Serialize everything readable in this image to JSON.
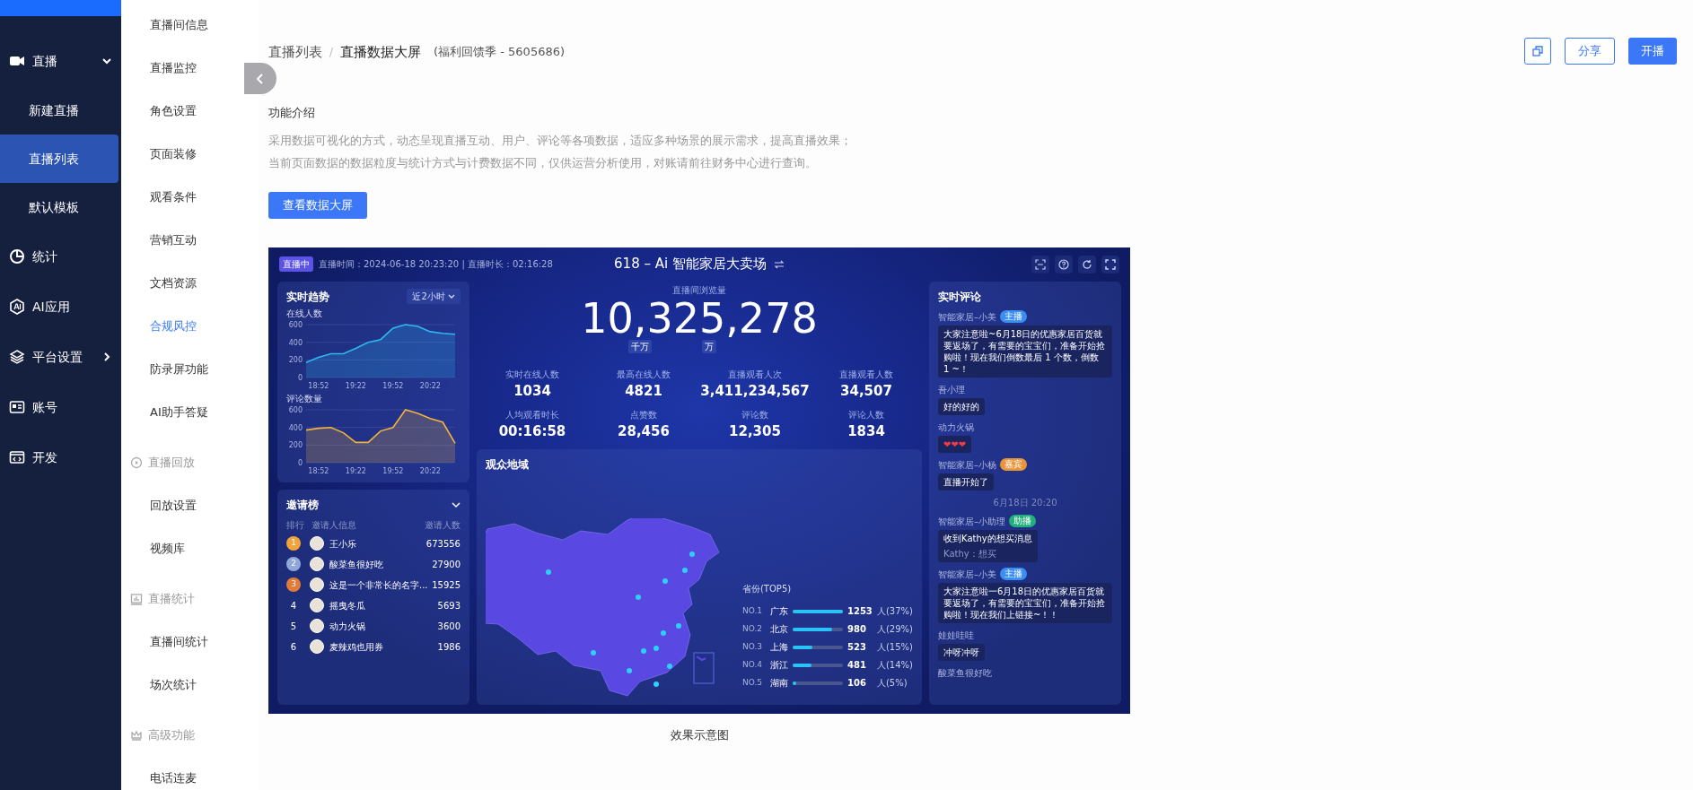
{
  "sidebar": {
    "items": [
      {
        "label": "直播",
        "kind": "group",
        "expanded": true,
        "selected": false,
        "children": [
          {
            "label": "新建直播",
            "selected": false
          },
          {
            "label": "直播列表",
            "selected": true
          },
          {
            "label": "默认模板",
            "selected": false
          }
        ]
      },
      {
        "label": "统计",
        "kind": "link",
        "selected": false
      },
      {
        "label": "AI应用",
        "kind": "link",
        "selected": false
      },
      {
        "label": "平台设置",
        "kind": "group",
        "expanded": false,
        "selected": false
      },
      {
        "label": "账号",
        "kind": "link",
        "selected": false
      },
      {
        "label": "开发",
        "kind": "link",
        "selected": false
      }
    ]
  },
  "subnav": {
    "sections": [
      {
        "items": [
          {
            "label": "直播间信息",
            "selected": false
          },
          {
            "label": "直播监控",
            "selected": false
          },
          {
            "label": "角色设置",
            "selected": false
          },
          {
            "label": "页面装修",
            "selected": false
          },
          {
            "label": "观看条件",
            "selected": false
          },
          {
            "label": "营销互动",
            "selected": false
          },
          {
            "label": "文档资源",
            "selected": false
          },
          {
            "label": "合规风控",
            "selected": true
          },
          {
            "label": "防录屏功能",
            "selected": false
          },
          {
            "label": "AI助手答疑",
            "selected": false
          }
        ]
      },
      {
        "heading": "直播回放",
        "items": [
          {
            "label": "回放设置",
            "selected": false
          },
          {
            "label": "视频库",
            "selected": false
          }
        ]
      },
      {
        "heading": "直播统计",
        "items": [
          {
            "label": "直播间统计",
            "selected": false
          },
          {
            "label": "场次统计",
            "selected": false
          }
        ]
      },
      {
        "heading": "高级功能",
        "items": [
          {
            "label": "电话连麦",
            "selected": false
          }
        ]
      }
    ]
  },
  "breadcrumb": {
    "items": [
      "直播列表",
      "直播数据大屏"
    ],
    "separator": "/",
    "note": "(福利回馈季 - 5605686)"
  },
  "actions": [
    "分享",
    "开播"
  ],
  "intro": {
    "title": "功能介绍",
    "lines": [
      "采用数据可视化的方式，动态呈现直播互动、用户、评论等各项数据，适应多种场景的展示需求，提高直播效果；",
      "当前页面数据的数据粒度与统计方式与计费数据不同，仅供运营分析使用，对账请前往财务中心进行查询。"
    ],
    "button": "查看数据大屏"
  },
  "preview": {
    "caption": "效果示意图",
    "dashboard": {
      "status": "直播中",
      "time_info": "直播时间：2024-06-18 20:23:20 | 直播时长：02:16:28",
      "title": "618 – Ai 智能家居大卖场",
      "trend": {
        "title": "实时趋势",
        "range": "近2小时",
        "charts": [
          {
            "chart_data": {
              "type": "area",
              "title": "在线人数",
              "categories": [
                null,
                "18:52",
                null,
                null,
                "19:22",
                null,
                null,
                "19:52",
                null,
                null,
                "20:22",
                null,
                null
              ],
              "grid": true,
              "ylim": [
                0,
                600
              ],
              "yticks": [
                0,
                200,
                400,
                600
              ],
              "series": [
                {
                  "color": "#2fb8f0",
                  "values": [
                    170,
                    230,
                    270,
                    270,
                    330,
                    400,
                    430,
                    560,
                    600,
                    580,
                    520,
                    500,
                    490
                  ]
                }
              ]
            }
          },
          {
            "chart_data": {
              "type": "area",
              "title": "评论数量",
              "categories": [
                null,
                "18:52",
                null,
                null,
                "19:22",
                null,
                null,
                "19:52",
                null,
                null,
                "20:22",
                null,
                null
              ],
              "grid": true,
              "ylim": [
                0,
                600
              ],
              "yticks": [
                0,
                200,
                400,
                600
              ],
              "series": [
                {
                  "color": "#f2b33d",
                  "values": [
                    370,
                    390,
                    400,
                    340,
                    230,
                    230,
                    360,
                    400,
                    600,
                    560,
                    500,
                    460,
                    220
                  ]
                }
              ]
            }
          }
        ]
      },
      "invite": {
        "title": "邀请榜",
        "columns": [
          "排行",
          "邀请人信息",
          "邀请人数"
        ],
        "rows": [
          {
            "rank": "1",
            "kind": "medal",
            "color": "#f0a53a",
            "name": "王小乐",
            "count": "673556"
          },
          {
            "rank": "2",
            "kind": "medal",
            "color": "#8fa8d8",
            "name": "酸菜鱼很好吃",
            "count": "27900"
          },
          {
            "rank": "3",
            "kind": "medal",
            "color": "#e27a3a",
            "name": "这是一个非常长的名字...",
            "count": "15925"
          },
          {
            "rank": "4",
            "kind": "plain",
            "name": "摇曳冬瓜",
            "count": "5693"
          },
          {
            "rank": "5",
            "kind": "plain",
            "name": "动力火锅",
            "count": "3600"
          },
          {
            "rank": "6",
            "kind": "plain",
            "name": "麦辣鸡也用券",
            "count": "1986"
          }
        ]
      },
      "views": {
        "label": "直播间浏览量",
        "value": "10,325,278",
        "units": [
          "千万",
          "万"
        ]
      },
      "stats": [
        {
          "label": "实时在线人数",
          "value": "1034"
        },
        {
          "label": "最高在线人数",
          "value": "4821"
        },
        {
          "label": "直播观看人次",
          "value": "3,411,234,567"
        },
        {
          "label": "直播观看人数",
          "value": "34,507"
        },
        {
          "label": "人均观看时长",
          "value": "00:16:58"
        },
        {
          "label": "点赞数",
          "value": "28,456"
        },
        {
          "label": "评论数",
          "value": "12,305"
        },
        {
          "label": "评论人数",
          "value": "1834"
        }
      ],
      "region": {
        "title": "观众地域",
        "top_title": "省份(TOP5)",
        "rows": [
          {
            "rank": "NO.1",
            "name": "广东",
            "level": 1.0,
            "count": "1253",
            "share": "人(37%)"
          },
          {
            "rank": "NO.2",
            "name": "北京",
            "level": 0.78,
            "count": "980",
            "share": "人(29%)"
          },
          {
            "rank": "NO.3",
            "name": "上海",
            "level": 0.4,
            "count": "523",
            "share": "人(15%)"
          },
          {
            "rank": "NO.4",
            "name": "浙江",
            "level": 0.37,
            "count": "481",
            "share": "人(14%)"
          },
          {
            "rank": "NO.5",
            "name": "湖南",
            "level": 0.08,
            "count": "106",
            "share": "人(5%)"
          }
        ]
      },
      "comments": {
        "title": "实时评论",
        "items": [
          {
            "kind": "message",
            "author": "智能家居–小美",
            "role": {
              "label": "主播",
              "color": "#3a8ef0"
            },
            "text": "大家注意啦~6月18日的优惠家居百货就要返场了，有需要的宝宝们，准备开始抢购啦！现在我们倒数最后 1 个数，倒数 1 ~！"
          },
          {
            "kind": "message",
            "author": "吾小理",
            "text": "好的好的"
          },
          {
            "kind": "message",
            "author": "动力火锅",
            "text": "❤❤❤"
          },
          {
            "kind": "message",
            "author": "智能家居–小杨",
            "role": {
              "label": "嘉宾",
              "color": "#e8953a"
            },
            "text": "直播开始了"
          },
          {
            "kind": "time",
            "text": "6月18日 20:20"
          },
          {
            "kind": "message",
            "author": "智能家居–小助理",
            "role": {
              "label": "助播",
              "color": "#22b07d"
            },
            "text": "收到Kathy的想买消息",
            "quote": "Kathy：想买"
          },
          {
            "kind": "message",
            "author": "智能家居–小美",
            "role": {
              "label": "主播",
              "color": "#3a8ef0"
            },
            "text": "大家注意啦一6月18日的优惠家居百货就要返场了，有需要的宝宝们，准备开始抢购啦！现在我们上链接~！！"
          },
          {
            "kind": "message",
            "author": "娃娃哇哇",
            "text": "冲呀冲呀"
          },
          {
            "kind": "message",
            "author": "酸菜鱼很好吃"
          }
        ]
      }
    }
  }
}
